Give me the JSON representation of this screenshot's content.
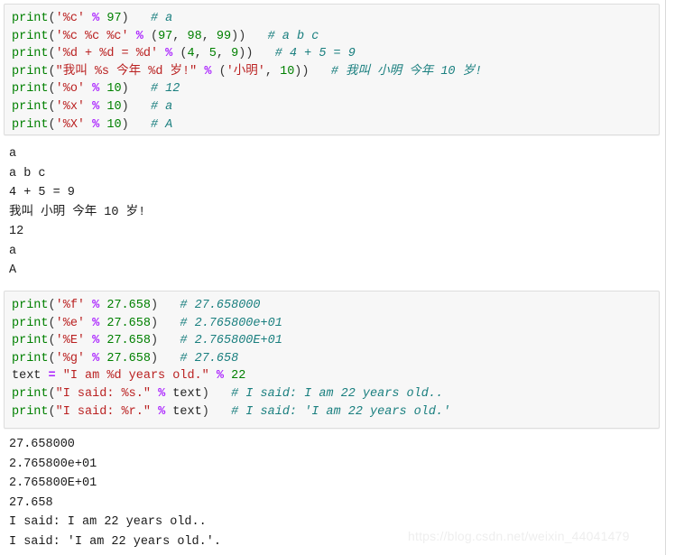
{
  "page": {
    "background_color": "#ffffff",
    "code_block_bg": "#f7f7f7",
    "code_block_border": "#dddddd",
    "watermark": "https://blog.csdn.net/weixin_44041479"
  },
  "colors": {
    "function": "#008000",
    "string": "#ba2121",
    "operator": "#aa22ff",
    "number": "#008000",
    "comment": "#1a7f7f",
    "plain": "#222222"
  },
  "code_block_1": {
    "lines": [
      {
        "id": "line-1",
        "tokens": [
          {
            "t": "print",
            "c": "t-fn"
          },
          {
            "t": "(",
            "c": "t-punc"
          },
          {
            "t": "'%c'",
            "c": "t-str"
          },
          {
            "t": " ",
            "c": "t-punc"
          },
          {
            "t": "%",
            "c": "t-op"
          },
          {
            "t": " ",
            "c": "t-punc"
          },
          {
            "t": "97",
            "c": "t-num"
          },
          {
            "t": ")",
            "c": "t-punc"
          },
          {
            "t": "   ",
            "c": "t-punc"
          },
          {
            "t": "# a",
            "c": "t-com"
          }
        ]
      },
      {
        "id": "line-2",
        "tokens": [
          {
            "t": "print",
            "c": "t-fn"
          },
          {
            "t": "(",
            "c": "t-punc"
          },
          {
            "t": "'%c %c %c'",
            "c": "t-str"
          },
          {
            "t": " ",
            "c": "t-punc"
          },
          {
            "t": "%",
            "c": "t-op"
          },
          {
            "t": " ",
            "c": "t-punc"
          },
          {
            "t": "(",
            "c": "t-punc"
          },
          {
            "t": "97",
            "c": "t-num"
          },
          {
            "t": ", ",
            "c": "t-punc"
          },
          {
            "t": "98",
            "c": "t-num"
          },
          {
            "t": ", ",
            "c": "t-punc"
          },
          {
            "t": "99",
            "c": "t-num"
          },
          {
            "t": "))",
            "c": "t-punc"
          },
          {
            "t": "   ",
            "c": "t-punc"
          },
          {
            "t": "# a b c",
            "c": "t-com"
          }
        ]
      },
      {
        "id": "line-3",
        "tokens": [
          {
            "t": "print",
            "c": "t-fn"
          },
          {
            "t": "(",
            "c": "t-punc"
          },
          {
            "t": "'%d + %d = %d'",
            "c": "t-str"
          },
          {
            "t": " ",
            "c": "t-punc"
          },
          {
            "t": "%",
            "c": "t-op"
          },
          {
            "t": " ",
            "c": "t-punc"
          },
          {
            "t": "(",
            "c": "t-punc"
          },
          {
            "t": "4",
            "c": "t-num"
          },
          {
            "t": ", ",
            "c": "t-punc"
          },
          {
            "t": "5",
            "c": "t-num"
          },
          {
            "t": ", ",
            "c": "t-punc"
          },
          {
            "t": "9",
            "c": "t-num"
          },
          {
            "t": "))",
            "c": "t-punc"
          },
          {
            "t": "   ",
            "c": "t-punc"
          },
          {
            "t": "# 4 + 5 = 9",
            "c": "t-com"
          }
        ]
      },
      {
        "id": "line-4",
        "tokens": [
          {
            "t": "print",
            "c": "t-fn"
          },
          {
            "t": "(",
            "c": "t-punc"
          },
          {
            "t": "\"我叫 %s 今年 %d 岁!\"",
            "c": "t-str"
          },
          {
            "t": " ",
            "c": "t-punc"
          },
          {
            "t": "%",
            "c": "t-op"
          },
          {
            "t": " ",
            "c": "t-punc"
          },
          {
            "t": "(",
            "c": "t-punc"
          },
          {
            "t": "'小明'",
            "c": "t-str"
          },
          {
            "t": ", ",
            "c": "t-punc"
          },
          {
            "t": "10",
            "c": "t-num"
          },
          {
            "t": "))",
            "c": "t-punc"
          },
          {
            "t": "   ",
            "c": "t-punc"
          },
          {
            "t": "# 我叫 小明 今年 10 岁!",
            "c": "t-com"
          }
        ]
      },
      {
        "id": "line-5",
        "tokens": [
          {
            "t": "print",
            "c": "t-fn"
          },
          {
            "t": "(",
            "c": "t-punc"
          },
          {
            "t": "'%o'",
            "c": "t-str"
          },
          {
            "t": " ",
            "c": "t-punc"
          },
          {
            "t": "%",
            "c": "t-op"
          },
          {
            "t": " ",
            "c": "t-punc"
          },
          {
            "t": "10",
            "c": "t-num"
          },
          {
            "t": ")",
            "c": "t-punc"
          },
          {
            "t": "   ",
            "c": "t-punc"
          },
          {
            "t": "# 12",
            "c": "t-com"
          }
        ]
      },
      {
        "id": "line-6",
        "tokens": [
          {
            "t": "print",
            "c": "t-fn"
          },
          {
            "t": "(",
            "c": "t-punc"
          },
          {
            "t": "'%x'",
            "c": "t-str"
          },
          {
            "t": " ",
            "c": "t-punc"
          },
          {
            "t": "%",
            "c": "t-op"
          },
          {
            "t": " ",
            "c": "t-punc"
          },
          {
            "t": "10",
            "c": "t-num"
          },
          {
            "t": ")",
            "c": "t-punc"
          },
          {
            "t": "   ",
            "c": "t-punc"
          },
          {
            "t": "# a",
            "c": "t-com"
          }
        ]
      },
      {
        "id": "line-7",
        "tokens": [
          {
            "t": "print",
            "c": "t-fn"
          },
          {
            "t": "(",
            "c": "t-punc"
          },
          {
            "t": "'%X'",
            "c": "t-str"
          },
          {
            "t": " ",
            "c": "t-punc"
          },
          {
            "t": "%",
            "c": "t-op"
          },
          {
            "t": " ",
            "c": "t-punc"
          },
          {
            "t": "10",
            "c": "t-num"
          },
          {
            "t": ")",
            "c": "t-punc"
          },
          {
            "t": "   ",
            "c": "t-punc"
          },
          {
            "t": "# A",
            "c": "t-com"
          }
        ]
      }
    ]
  },
  "output_block_1": {
    "lines": [
      "a",
      "a b c",
      "4 + 5 = 9",
      "我叫 小明 今年 10 岁!",
      "12",
      "a",
      "A"
    ]
  },
  "code_block_2": {
    "lines": [
      {
        "id": "line-1",
        "tokens": [
          {
            "t": "print",
            "c": "t-fn"
          },
          {
            "t": "(",
            "c": "t-punc"
          },
          {
            "t": "'%f'",
            "c": "t-str"
          },
          {
            "t": " ",
            "c": "t-punc"
          },
          {
            "t": "%",
            "c": "t-op"
          },
          {
            "t": " ",
            "c": "t-punc"
          },
          {
            "t": "27.658",
            "c": "t-num"
          },
          {
            "t": ")",
            "c": "t-punc"
          },
          {
            "t": "   ",
            "c": "t-punc"
          },
          {
            "t": "# 27.658000",
            "c": "t-com"
          }
        ]
      },
      {
        "id": "line-2",
        "tokens": [
          {
            "t": "print",
            "c": "t-fn"
          },
          {
            "t": "(",
            "c": "t-punc"
          },
          {
            "t": "'%e'",
            "c": "t-str"
          },
          {
            "t": " ",
            "c": "t-punc"
          },
          {
            "t": "%",
            "c": "t-op"
          },
          {
            "t": " ",
            "c": "t-punc"
          },
          {
            "t": "27.658",
            "c": "t-num"
          },
          {
            "t": ")",
            "c": "t-punc"
          },
          {
            "t": "   ",
            "c": "t-punc"
          },
          {
            "t": "# 2.765800e+01",
            "c": "t-com"
          }
        ]
      },
      {
        "id": "line-3",
        "tokens": [
          {
            "t": "print",
            "c": "t-fn"
          },
          {
            "t": "(",
            "c": "t-punc"
          },
          {
            "t": "'%E'",
            "c": "t-str"
          },
          {
            "t": " ",
            "c": "t-punc"
          },
          {
            "t": "%",
            "c": "t-op"
          },
          {
            "t": " ",
            "c": "t-punc"
          },
          {
            "t": "27.658",
            "c": "t-num"
          },
          {
            "t": ")",
            "c": "t-punc"
          },
          {
            "t": "   ",
            "c": "t-punc"
          },
          {
            "t": "# 2.765800E+01",
            "c": "t-com"
          }
        ]
      },
      {
        "id": "line-4",
        "tokens": [
          {
            "t": "print",
            "c": "t-fn"
          },
          {
            "t": "(",
            "c": "t-punc"
          },
          {
            "t": "'%g'",
            "c": "t-str"
          },
          {
            "t": " ",
            "c": "t-punc"
          },
          {
            "t": "%",
            "c": "t-op"
          },
          {
            "t": " ",
            "c": "t-punc"
          },
          {
            "t": "27.658",
            "c": "t-num"
          },
          {
            "t": ")",
            "c": "t-punc"
          },
          {
            "t": "   ",
            "c": "t-punc"
          },
          {
            "t": "# 27.658",
            "c": "t-com"
          }
        ]
      },
      {
        "id": "line-5",
        "tokens": [
          {
            "t": "text",
            "c": "t-name"
          },
          {
            "t": " ",
            "c": "t-punc"
          },
          {
            "t": "=",
            "c": "t-op"
          },
          {
            "t": " ",
            "c": "t-punc"
          },
          {
            "t": "\"I am %d years old.\"",
            "c": "t-str"
          },
          {
            "t": " ",
            "c": "t-punc"
          },
          {
            "t": "%",
            "c": "t-op"
          },
          {
            "t": " ",
            "c": "t-punc"
          },
          {
            "t": "22",
            "c": "t-num"
          }
        ]
      },
      {
        "id": "line-6",
        "tokens": [
          {
            "t": "print",
            "c": "t-fn"
          },
          {
            "t": "(",
            "c": "t-punc"
          },
          {
            "t": "\"I said: %s.\"",
            "c": "t-str"
          },
          {
            "t": " ",
            "c": "t-punc"
          },
          {
            "t": "%",
            "c": "t-op"
          },
          {
            "t": " ",
            "c": "t-punc"
          },
          {
            "t": "text",
            "c": "t-name"
          },
          {
            "t": ")",
            "c": "t-punc"
          },
          {
            "t": "   ",
            "c": "t-punc"
          },
          {
            "t": "# I said: I am 22 years old..",
            "c": "t-com"
          }
        ]
      },
      {
        "id": "line-7",
        "tokens": [
          {
            "t": "print",
            "c": "t-fn"
          },
          {
            "t": "(",
            "c": "t-punc"
          },
          {
            "t": "\"I said: %r.\"",
            "c": "t-str"
          },
          {
            "t": " ",
            "c": "t-punc"
          },
          {
            "t": "%",
            "c": "t-op"
          },
          {
            "t": " ",
            "c": "t-punc"
          },
          {
            "t": "text",
            "c": "t-name"
          },
          {
            "t": ")",
            "c": "t-punc"
          },
          {
            "t": "   ",
            "c": "t-punc"
          },
          {
            "t": "# I said: 'I am 22 years old.'",
            "c": "t-com"
          }
        ]
      }
    ]
  },
  "output_block_2": {
    "lines": [
      "27.658000",
      "2.765800e+01",
      "2.765800E+01",
      "27.658",
      "I said: I am 22 years old..",
      "I said: 'I am 22 years old.'."
    ]
  }
}
